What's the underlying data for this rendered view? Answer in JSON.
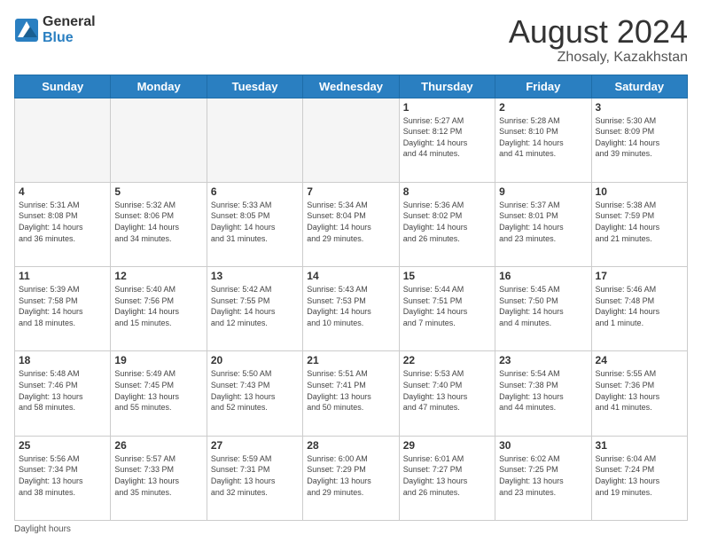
{
  "header": {
    "logo_line1": "General",
    "logo_line2": "Blue",
    "title": "August 2024",
    "subtitle": "Zhosaly, Kazakhstan"
  },
  "days_of_week": [
    "Sunday",
    "Monday",
    "Tuesday",
    "Wednesday",
    "Thursday",
    "Friday",
    "Saturday"
  ],
  "weeks": [
    [
      {
        "day": "",
        "info": ""
      },
      {
        "day": "",
        "info": ""
      },
      {
        "day": "",
        "info": ""
      },
      {
        "day": "",
        "info": ""
      },
      {
        "day": "1",
        "info": "Sunrise: 5:27 AM\nSunset: 8:12 PM\nDaylight: 14 hours\nand 44 minutes."
      },
      {
        "day": "2",
        "info": "Sunrise: 5:28 AM\nSunset: 8:10 PM\nDaylight: 14 hours\nand 41 minutes."
      },
      {
        "day": "3",
        "info": "Sunrise: 5:30 AM\nSunset: 8:09 PM\nDaylight: 14 hours\nand 39 minutes."
      }
    ],
    [
      {
        "day": "4",
        "info": "Sunrise: 5:31 AM\nSunset: 8:08 PM\nDaylight: 14 hours\nand 36 minutes."
      },
      {
        "day": "5",
        "info": "Sunrise: 5:32 AM\nSunset: 8:06 PM\nDaylight: 14 hours\nand 34 minutes."
      },
      {
        "day": "6",
        "info": "Sunrise: 5:33 AM\nSunset: 8:05 PM\nDaylight: 14 hours\nand 31 minutes."
      },
      {
        "day": "7",
        "info": "Sunrise: 5:34 AM\nSunset: 8:04 PM\nDaylight: 14 hours\nand 29 minutes."
      },
      {
        "day": "8",
        "info": "Sunrise: 5:36 AM\nSunset: 8:02 PM\nDaylight: 14 hours\nand 26 minutes."
      },
      {
        "day": "9",
        "info": "Sunrise: 5:37 AM\nSunset: 8:01 PM\nDaylight: 14 hours\nand 23 minutes."
      },
      {
        "day": "10",
        "info": "Sunrise: 5:38 AM\nSunset: 7:59 PM\nDaylight: 14 hours\nand 21 minutes."
      }
    ],
    [
      {
        "day": "11",
        "info": "Sunrise: 5:39 AM\nSunset: 7:58 PM\nDaylight: 14 hours\nand 18 minutes."
      },
      {
        "day": "12",
        "info": "Sunrise: 5:40 AM\nSunset: 7:56 PM\nDaylight: 14 hours\nand 15 minutes."
      },
      {
        "day": "13",
        "info": "Sunrise: 5:42 AM\nSunset: 7:55 PM\nDaylight: 14 hours\nand 12 minutes."
      },
      {
        "day": "14",
        "info": "Sunrise: 5:43 AM\nSunset: 7:53 PM\nDaylight: 14 hours\nand 10 minutes."
      },
      {
        "day": "15",
        "info": "Sunrise: 5:44 AM\nSunset: 7:51 PM\nDaylight: 14 hours\nand 7 minutes."
      },
      {
        "day": "16",
        "info": "Sunrise: 5:45 AM\nSunset: 7:50 PM\nDaylight: 14 hours\nand 4 minutes."
      },
      {
        "day": "17",
        "info": "Sunrise: 5:46 AM\nSunset: 7:48 PM\nDaylight: 14 hours\nand 1 minute."
      }
    ],
    [
      {
        "day": "18",
        "info": "Sunrise: 5:48 AM\nSunset: 7:46 PM\nDaylight: 13 hours\nand 58 minutes."
      },
      {
        "day": "19",
        "info": "Sunrise: 5:49 AM\nSunset: 7:45 PM\nDaylight: 13 hours\nand 55 minutes."
      },
      {
        "day": "20",
        "info": "Sunrise: 5:50 AM\nSunset: 7:43 PM\nDaylight: 13 hours\nand 52 minutes."
      },
      {
        "day": "21",
        "info": "Sunrise: 5:51 AM\nSunset: 7:41 PM\nDaylight: 13 hours\nand 50 minutes."
      },
      {
        "day": "22",
        "info": "Sunrise: 5:53 AM\nSunset: 7:40 PM\nDaylight: 13 hours\nand 47 minutes."
      },
      {
        "day": "23",
        "info": "Sunrise: 5:54 AM\nSunset: 7:38 PM\nDaylight: 13 hours\nand 44 minutes."
      },
      {
        "day": "24",
        "info": "Sunrise: 5:55 AM\nSunset: 7:36 PM\nDaylight: 13 hours\nand 41 minutes."
      }
    ],
    [
      {
        "day": "25",
        "info": "Sunrise: 5:56 AM\nSunset: 7:34 PM\nDaylight: 13 hours\nand 38 minutes."
      },
      {
        "day": "26",
        "info": "Sunrise: 5:57 AM\nSunset: 7:33 PM\nDaylight: 13 hours\nand 35 minutes."
      },
      {
        "day": "27",
        "info": "Sunrise: 5:59 AM\nSunset: 7:31 PM\nDaylight: 13 hours\nand 32 minutes."
      },
      {
        "day": "28",
        "info": "Sunrise: 6:00 AM\nSunset: 7:29 PM\nDaylight: 13 hours\nand 29 minutes."
      },
      {
        "day": "29",
        "info": "Sunrise: 6:01 AM\nSunset: 7:27 PM\nDaylight: 13 hours\nand 26 minutes."
      },
      {
        "day": "30",
        "info": "Sunrise: 6:02 AM\nSunset: 7:25 PM\nDaylight: 13 hours\nand 23 minutes."
      },
      {
        "day": "31",
        "info": "Sunrise: 6:04 AM\nSunset: 7:24 PM\nDaylight: 13 hours\nand 19 minutes."
      }
    ]
  ],
  "footer": {
    "label": "Daylight hours"
  }
}
